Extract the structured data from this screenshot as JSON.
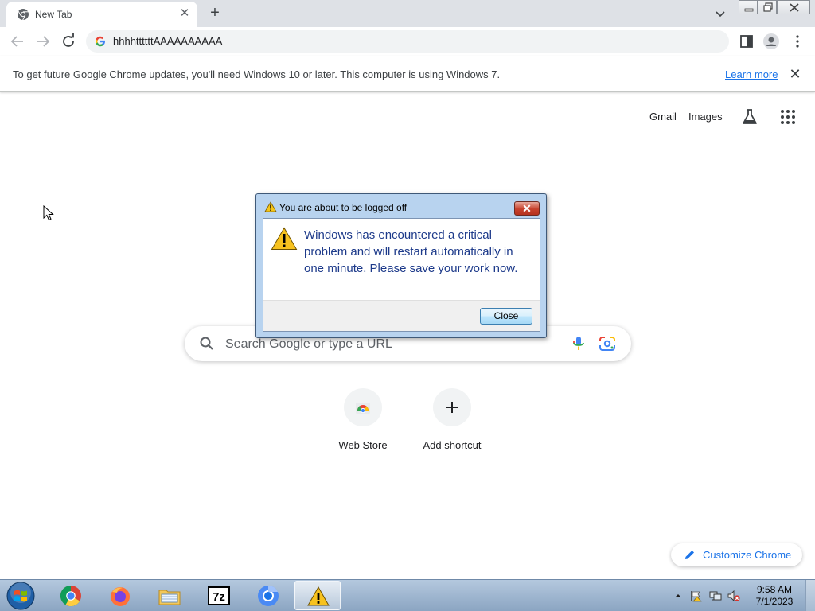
{
  "browser": {
    "tab": {
      "title": "New Tab",
      "favicon": "chrome-icon"
    },
    "omnibox": {
      "value": "hhhhttttttAAAAAAAAAA",
      "icon": "google-g-icon"
    }
  },
  "infobar": {
    "message": "To get future Google Chrome updates, you'll need Windows 10 or later. This computer is using Windows 7.",
    "link": "Learn more",
    "close_glyph": "✕"
  },
  "ntp": {
    "header_links": {
      "gmail": "Gmail",
      "images": "Images"
    },
    "search": {
      "placeholder": "Search Google or type a URL"
    },
    "shortcuts": [
      {
        "label": "Web Store"
      },
      {
        "label": "Add shortcut"
      }
    ],
    "customize": "Customize Chrome"
  },
  "dialog": {
    "title": "You are about to be logged off",
    "message": "Windows has encountered a critical problem and will restart automatically in one minute. Please save your work now.",
    "button": "Close",
    "close_glyph": "✕"
  },
  "taskbar": {
    "apps": [
      "chrome-icon",
      "firefox-icon",
      "file-explorer-icon",
      "7zip-icon",
      "chromium-icon",
      "warning-icon"
    ],
    "active_app": "warning-icon",
    "clock": {
      "time": "9:58 AM",
      "date": "7/1/2023"
    }
  },
  "colors": {
    "accent": "#1a73e8",
    "tabstrip": "#dee1e6",
    "dialog_message": "#1d3a8a",
    "taskbar": "#9db4cf"
  }
}
